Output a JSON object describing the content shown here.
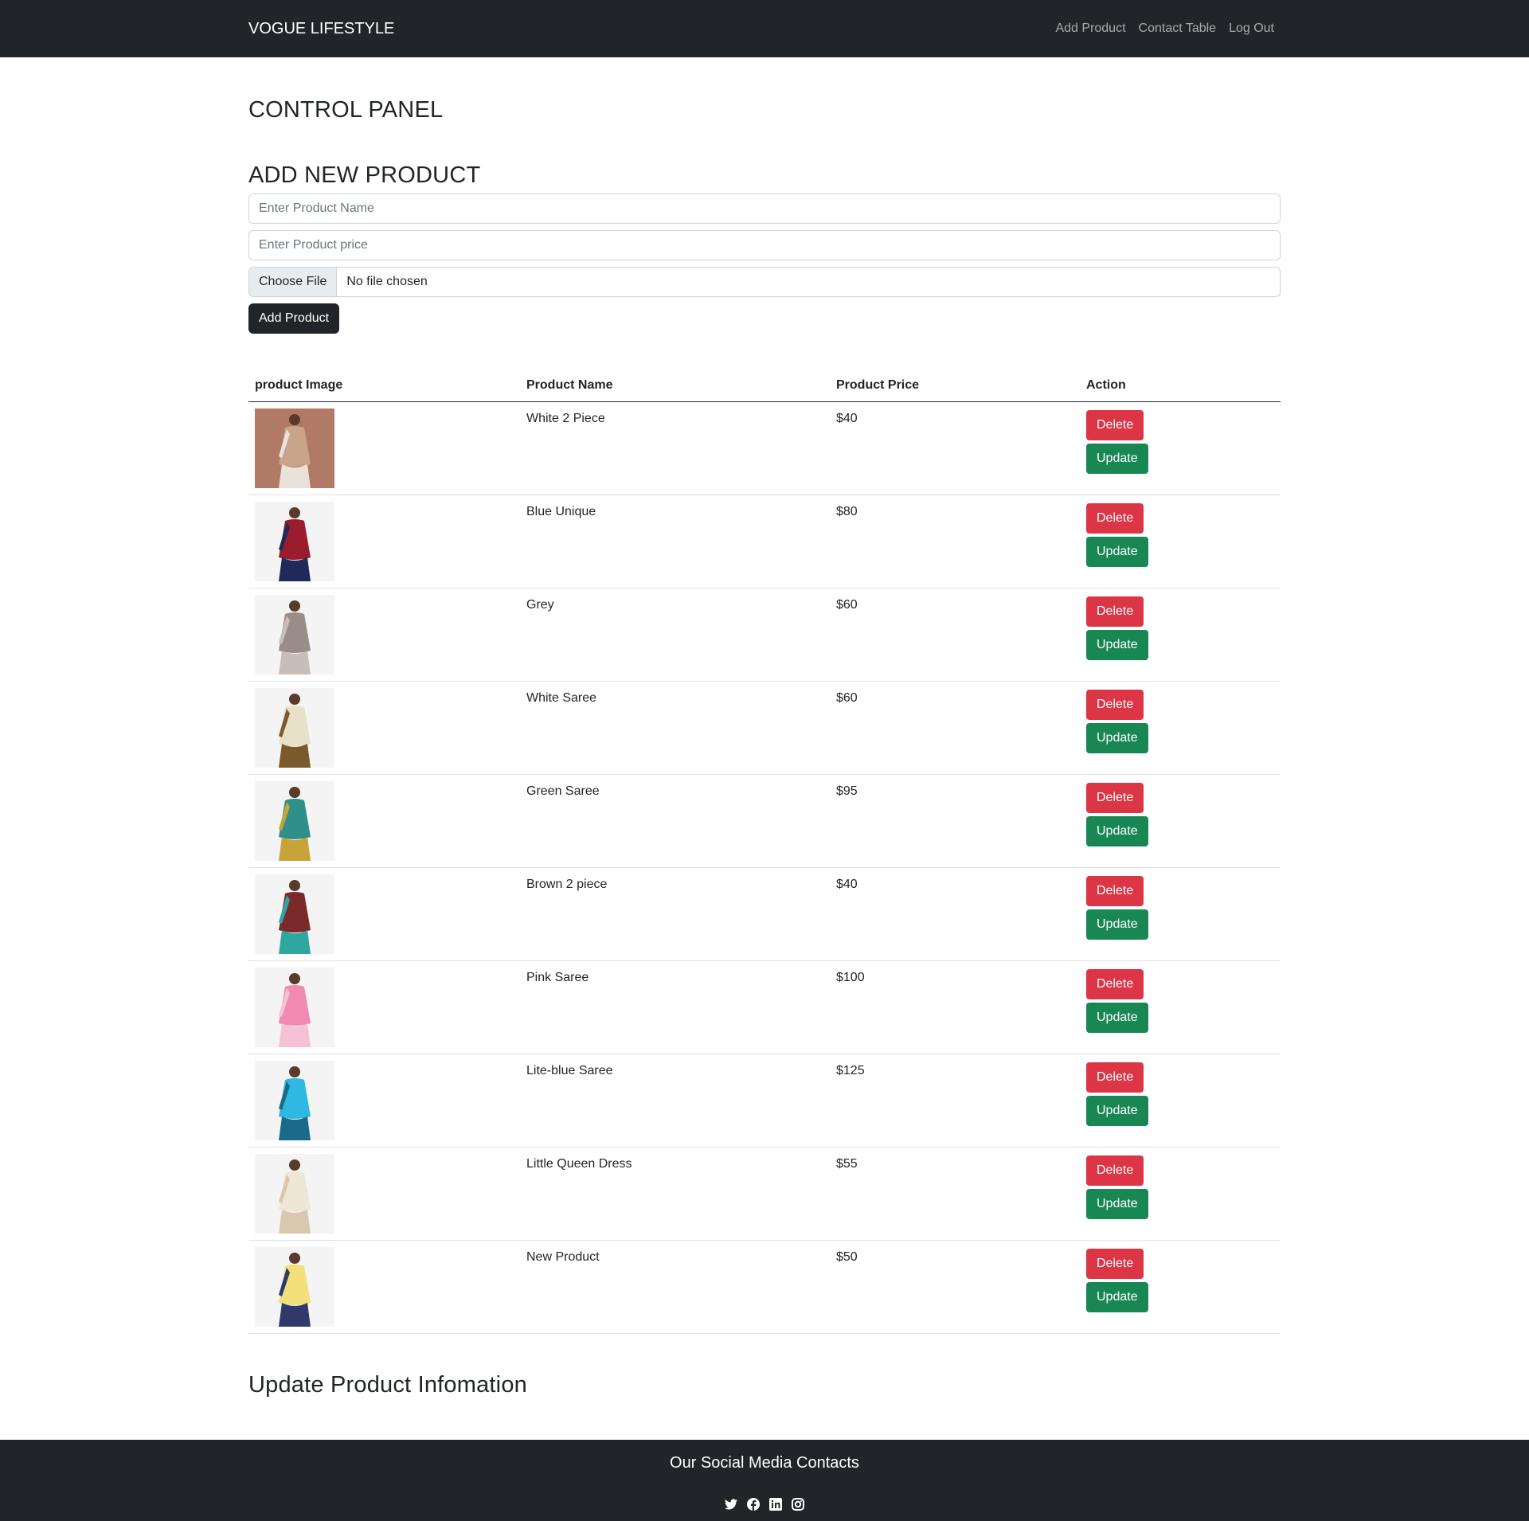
{
  "navbar": {
    "brand": "VOGUE LIFESTYLE",
    "links": [
      "Add Product",
      "Contact Table",
      "Log Out"
    ]
  },
  "page": {
    "title": "CONTROL PANEL",
    "add_title": "ADD NEW PRODUCT",
    "name_placeholder": "Enter Product Name",
    "price_placeholder": "Enter Product price",
    "file_button": "Choose File",
    "file_status": "No file chosen",
    "submit_label": "Add Product",
    "update_title": "Update Product Infomation"
  },
  "table": {
    "headers": [
      "product Image",
      "Product Name",
      "Product Price",
      "Action"
    ],
    "delete_label": "Delete",
    "update_label": "Update",
    "rows": [
      {
        "name": "White 2 Piece",
        "price": "$40",
        "colors": [
          "#c9a48a",
          "#e8e2da",
          "#b07a66"
        ]
      },
      {
        "name": "Blue Unique",
        "price": "$80",
        "colors": [
          "#9b1c2c",
          "#1f2a5a",
          "#f4f4f4"
        ]
      },
      {
        "name": "Grey",
        "price": "$60",
        "colors": [
          "#9a8c88",
          "#c9bdb7",
          "#f4f4f4"
        ]
      },
      {
        "name": "White Saree",
        "price": "$60",
        "colors": [
          "#e8e0c8",
          "#7a5a2a",
          "#f4f4f4"
        ]
      },
      {
        "name": "Green Saree",
        "price": "$95",
        "colors": [
          "#2f8f8a",
          "#c8a33a",
          "#f4f4f4"
        ]
      },
      {
        "name": "Brown 2 piece",
        "price": "$40",
        "colors": [
          "#7a2a2a",
          "#2fa6a0",
          "#f4f4f4"
        ]
      },
      {
        "name": "Pink Saree",
        "price": "$100",
        "colors": [
          "#f08ab0",
          "#f6c1d4",
          "#f4f4f4"
        ]
      },
      {
        "name": "Lite-blue Saree",
        "price": "$125",
        "colors": [
          "#2fb8e0",
          "#1a6a8a",
          "#f4f4f4"
        ]
      },
      {
        "name": "Little Queen Dress",
        "price": "$55",
        "colors": [
          "#f0e6d6",
          "#d9c8b0",
          "#f4f4f4"
        ]
      },
      {
        "name": "New Product",
        "price": "$50",
        "colors": [
          "#f3e07a",
          "#2f3a6a",
          "#f4f4f4"
        ]
      }
    ]
  },
  "footer": {
    "title": "Our Social Media Contacts",
    "icons": [
      "twitter-icon",
      "facebook-icon",
      "linkedin-icon",
      "instagram-icon"
    ]
  }
}
